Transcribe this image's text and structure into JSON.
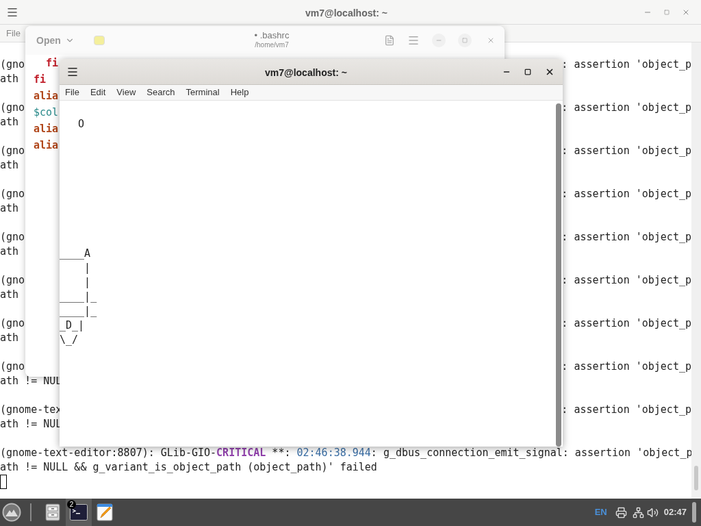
{
  "background_terminal": {
    "title": "vm7@localhost: ~",
    "menu": [
      "File"
    ],
    "messages": [
      {
        "left": [
          "(gno",
          "ath"
        ],
        "right": ": assertion 'object_p"
      },
      {
        "left": [
          "(gno",
          "ath"
        ],
        "right": ": assertion 'object_p"
      },
      {
        "left": [
          "(gno",
          "ath"
        ],
        "right": ": assertion 'object_p"
      },
      {
        "left": [
          "(gno",
          "ath"
        ],
        "right": ": assertion 'object_p"
      },
      {
        "left": [
          "(gno",
          "ath"
        ],
        "right": ": assertion 'object_p"
      },
      {
        "left": [
          "(gno",
          "ath"
        ],
        "right": ": assertion 'object_p"
      },
      {
        "left": [
          "(gno",
          "ath"
        ],
        "right": ": assertion 'object_p"
      },
      {
        "left": [
          "(gno",
          "ath != NUL"
        ],
        "right": ": assertion 'object_p"
      },
      {
        "left": [
          "(gnome-tex",
          "ath != NUL"
        ],
        "right": ": assertion 'object_p"
      }
    ],
    "last_message": {
      "segments": [
        {
          "text": "(gnome-text-editor:8807): GLib-GIO-",
          "kind": "plain"
        },
        {
          "text": "CRITICAL",
          "kind": "level"
        },
        {
          "text": " **: ",
          "kind": "plain"
        },
        {
          "text": "02:46:38.944",
          "kind": "time"
        },
        {
          "text": ": g_dbus_connection_emit_signal: assertion 'object_p",
          "kind": "plain"
        }
      ],
      "continuation": "ath != NULL && g_variant_is_object_path (object_path)' failed"
    },
    "cursor_visible": true
  },
  "text_editor": {
    "title_mark": "•",
    "title": ".bashrc",
    "subtitle": "/home/vm7",
    "open_button": "Open",
    "lines": [
      {
        "text": "  fi",
        "kind": "keyword"
      },
      {
        "text": "fi",
        "kind": "keyword"
      },
      {
        "text": "alia",
        "kind": "builtin"
      },
      {
        "text": "$col",
        "kind": "variable"
      },
      {
        "text": "alia",
        "kind": "builtin"
      },
      {
        "text": "alia",
        "kind": "builtin"
      }
    ]
  },
  "terminal": {
    "title": "vm7@localhost: ~",
    "menu": [
      "File",
      "Edit",
      "View",
      "Search",
      "Terminal",
      "Help"
    ],
    "output": "\n   O\n\n\n\n\n\n\n\n\n____A\n    |\n    |\n____|_\n____|_\n_D_|\n\\_/"
  },
  "taskbar": {
    "apps": [
      {
        "kind": "files",
        "selected": false
      },
      {
        "kind": "terminal",
        "selected": true,
        "badge": "2"
      },
      {
        "kind": "editor",
        "selected": false
      }
    ],
    "keyboard_layout": "EN",
    "clock": "02:47"
  }
}
